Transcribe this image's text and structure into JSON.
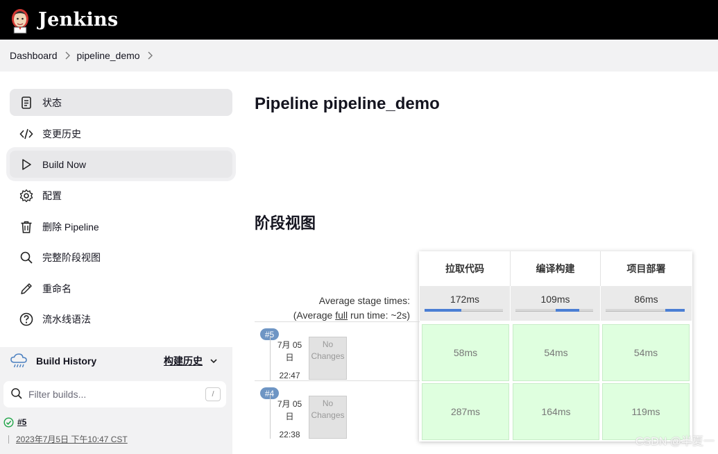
{
  "header": {
    "brand": "Jenkins"
  },
  "breadcrumb": {
    "items": [
      "Dashboard",
      "pipeline_demo"
    ]
  },
  "sidebar": {
    "tasks": [
      {
        "label": "状态",
        "icon": "status-icon"
      },
      {
        "label": "变更历史",
        "icon": "code-icon"
      },
      {
        "label": "Build Now",
        "icon": "play-icon"
      },
      {
        "label": "配置",
        "icon": "gear-icon"
      },
      {
        "label": "删除 Pipeline",
        "icon": "trash-icon"
      },
      {
        "label": "完整阶段视图",
        "icon": "search-icon"
      },
      {
        "label": "重命名",
        "icon": "pencil-icon"
      },
      {
        "label": "流水线语法",
        "icon": "help-icon"
      }
    ]
  },
  "build_history": {
    "title": "Build History",
    "trend_label": "构建历史",
    "filter_placeholder": "Filter builds...",
    "shortcut": "/",
    "builds": [
      {
        "number": "#5",
        "time": "2023年7月5日 下午10:47 CST",
        "status": "success"
      }
    ]
  },
  "main": {
    "title": "Pipeline pipeline_demo",
    "stage_view_title": "阶段视图"
  },
  "stage_view": {
    "stages": [
      "拉取代码",
      "编译构建",
      "项目部署"
    ],
    "avg_label": "Average stage times:",
    "avg_full_prefix": "(Average ",
    "avg_full_link": "full",
    "avg_full_suffix": " run time: ~2s)",
    "avg_times": [
      "172ms",
      "109ms",
      "86ms"
    ],
    "avg_progress": [
      {
        "start": 0,
        "end": 0.47
      },
      {
        "start": 0.52,
        "end": 0.82
      },
      {
        "start": 0.75,
        "end": 1.0
      }
    ],
    "runs": [
      {
        "badge": "#5",
        "date": "7月 05",
        "day": "日",
        "time": "22:47",
        "changes": "No Changes",
        "durations": [
          "58ms",
          "54ms",
          "54ms"
        ]
      },
      {
        "badge": "#4",
        "date": "7月 05",
        "day": "日",
        "time": "22:38",
        "changes": "No Changes",
        "durations": [
          "287ms",
          "164ms",
          "119ms"
        ]
      }
    ]
  },
  "colors": {
    "success": "#d8f5d8",
    "progress": "#4b7ed4",
    "header": "#000000"
  },
  "watermark": "CSDN @半夏一"
}
